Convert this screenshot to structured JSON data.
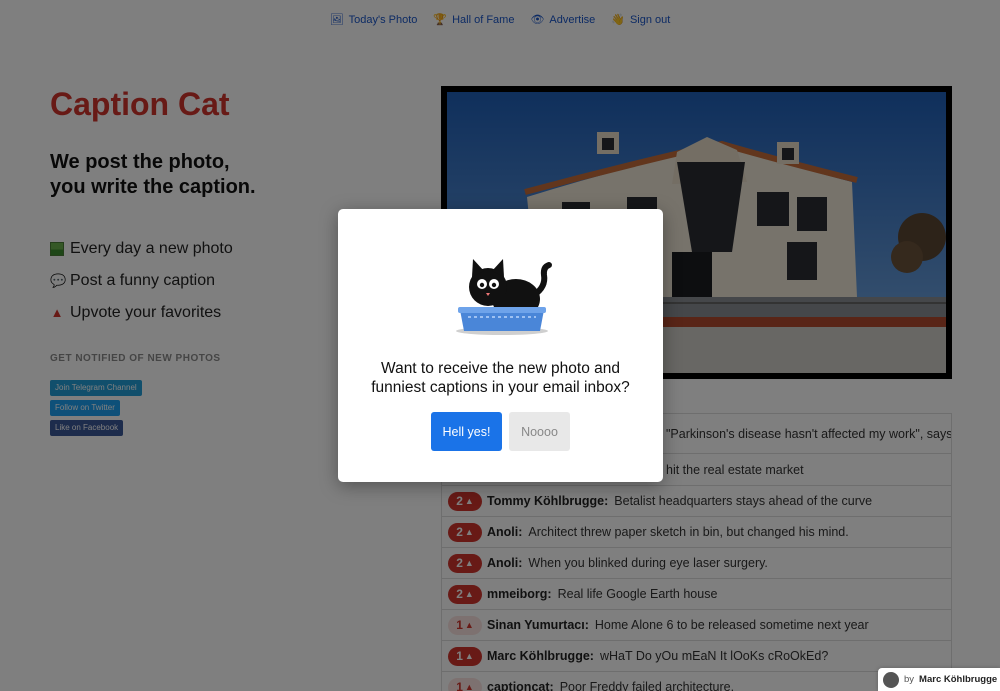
{
  "nav": [
    {
      "icon": "frame-icon",
      "glyph": "🖼",
      "label": "Today's Photo"
    },
    {
      "icon": "trophy-icon",
      "glyph": "🏆",
      "label": "Hall of Fame"
    },
    {
      "icon": "eye-icon",
      "glyph": "👁",
      "label": "Advertise"
    },
    {
      "icon": "wave-icon",
      "glyph": "👋",
      "label": "Sign out"
    }
  ],
  "brand": "Caption Cat",
  "tagline": {
    "line1": "We post the photo,",
    "line2": "you write the caption."
  },
  "features": [
    {
      "icon": "photo-icon",
      "label": "Every day a new photo"
    },
    {
      "icon": "speech-bubble-icon",
      "label": "Post a funny caption"
    },
    {
      "icon": "upvote-triangle-icon",
      "label": "Upvote your favorites"
    }
  ],
  "notify": {
    "heading": "GET NOTIFIED OF NEW PHOTOS",
    "telegram": "Join Telegram Channel",
    "twitter": "Follow on Twitter",
    "facebook": "Like on Facebook"
  },
  "captions": [
    {
      "votes": "",
      "author": "",
      "text": "\"Parkinson's disease hasn't affected my work\", says"
    },
    {
      "votes": "",
      "author": "",
      "text": "hit the real estate market"
    },
    {
      "votes": "2",
      "author": "Tommy Köhlbrugge:",
      "text": "Betalist headquarters stays ahead of the curve"
    },
    {
      "votes": "2",
      "author": "Anoli:",
      "text": "Architect threw paper sketch in bin, but changed his mind."
    },
    {
      "votes": "2",
      "author": "Anoli:",
      "text": "When you blinked during eye laser surgery."
    },
    {
      "votes": "2",
      "author": "mmeiborg:",
      "text": "Real life Google Earth house"
    },
    {
      "votes": "1",
      "author": "Sinan Yumurtacı:",
      "text": "Home Alone 6 to be released sometime next year"
    },
    {
      "votes": "1",
      "author": "Marc Köhlbrugge:",
      "text": "wHaT Do yOu mEaN It lOoKs cRoOkEd?"
    },
    {
      "votes": "1",
      "author": "captioncat:",
      "text": "Poor Freddy failed architecture."
    }
  ],
  "modal": {
    "message_line1": "Want to receive the new photo and",
    "message_line2": "funniest captions in your email inbox?",
    "yes": "Hell yes!",
    "no": "Noooo"
  },
  "credit": {
    "prefix": "by",
    "name": "Marc Köhlbrugge"
  },
  "colors": {
    "brand": "#d0342c",
    "link": "#1a56c9",
    "primary_button": "#1a73e8"
  }
}
